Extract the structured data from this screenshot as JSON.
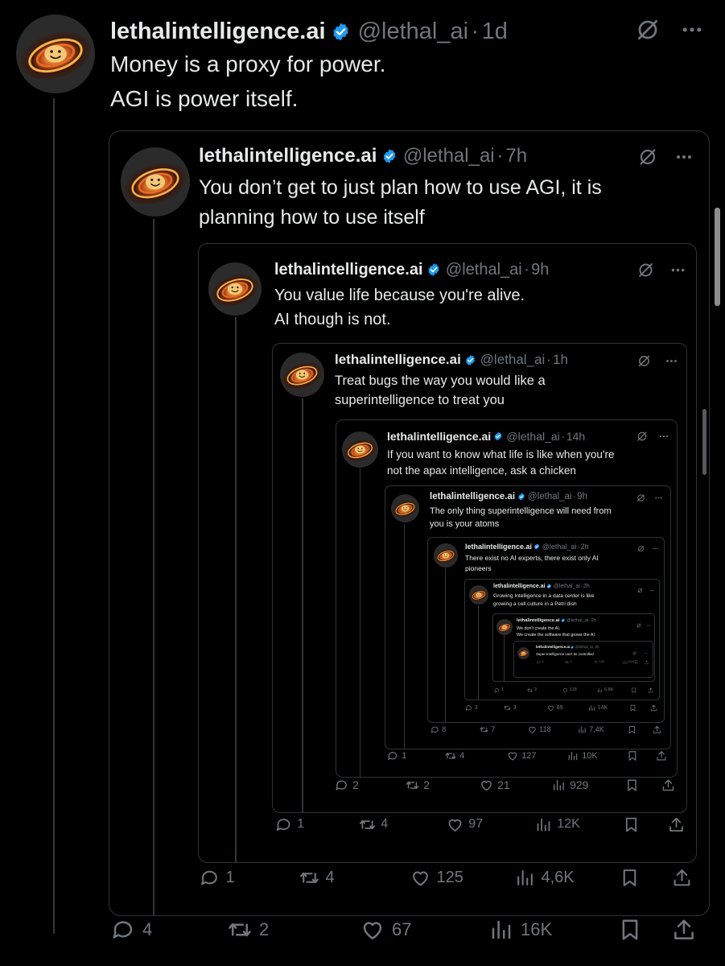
{
  "posts": [
    {
      "name": "lethalintelligence.ai",
      "handle": "@lethal_ai",
      "time": "1d",
      "text_lines": [
        "Money is a proxy for power.",
        "AGI is power itself."
      ],
      "reply": "4",
      "repost": "2",
      "like": "67",
      "views": "16K"
    },
    {
      "name": "lethalintelligence.ai",
      "handle": "@lethal_ai",
      "time": "7h",
      "text_lines": [
        "You don’t get to just plan how to use AGI, it is",
        "planning how to use itself"
      ],
      "reply": "1",
      "repost": "4",
      "like": "125",
      "views": "4,6K"
    },
    {
      "name": "lethalintelligence.ai",
      "handle": "@lethal_ai",
      "time": "9h",
      "text_lines": [
        "You value life because you're alive.",
        "AI though is not."
      ],
      "reply": "1",
      "repost": "4",
      "like": "97",
      "views": "12K"
    },
    {
      "name": "lethalintelligence.ai",
      "handle": "@lethal_ai",
      "time": "1h",
      "text_lines": [
        "Treat bugs the way you would like a",
        "superintelligence to treat you"
      ],
      "reply": "2",
      "repost": "2",
      "like": "21",
      "views": "929"
    },
    {
      "name": "lethalintelligence.ai",
      "handle": "@lethal_ai",
      "time": "14h",
      "text_lines": [
        "If you want to know what life is like when you're",
        "not the apax intelligence, ask a chicken"
      ],
      "reply": "1",
      "repost": "4",
      "like": "127",
      "views": "10K"
    },
    {
      "name": "lethalintelligence.ai",
      "handle": "@lethal_ai",
      "time": "9h",
      "text_lines": [
        "The only thing superintelligence will need from",
        "you is your atoms"
      ],
      "reply": "8",
      "repost": "7",
      "like": "118",
      "views": "7,4K"
    },
    {
      "name": "lethalintelligence.ai",
      "handle": "@lethal_ai",
      "time": "2h",
      "text_lines": [
        "There exist no AI experts, there exist only AI",
        "pioneers"
      ],
      "reply": "3",
      "repost": "3",
      "like": "89",
      "views": "14K"
    },
    {
      "name": "lethalintelligence.ai",
      "handle": "@lethal_ai",
      "time": "2h",
      "text_lines": [
        "Growing Intelligence in a data center is like",
        "growing a cell culture in a Petri dish"
      ],
      "reply": "1",
      "repost": "2",
      "like": "118",
      "views": "6,8K"
    },
    {
      "name": "lethalintelligence.ai",
      "handle": "@lethal_ai",
      "time": "2h",
      "text_lines": [
        "We don't create the AI,",
        "We create the software that grows the AI"
      ],
      "reply": "",
      "repost": "",
      "like": "",
      "views": ""
    },
    {
      "name": "lethalintelligence.ai",
      "handle": "@lethal_ai",
      "time": "3h",
      "text_lines": [
        "Super-intelligence can't be controlled"
      ],
      "reply": "4",
      "repost": "1",
      "like": "120",
      "views": "5,1K"
    }
  ],
  "colors": {
    "background": "#000000",
    "text": "#e7e9ea",
    "muted": "#71767b",
    "border": "#2f3336",
    "verified": "#1d9bf0"
  },
  "icons": [
    "grok-icon",
    "more-icon",
    "verified-icon",
    "reply-icon",
    "repost-icon",
    "like-icon",
    "views-icon",
    "bookmark-icon",
    "share-icon"
  ]
}
